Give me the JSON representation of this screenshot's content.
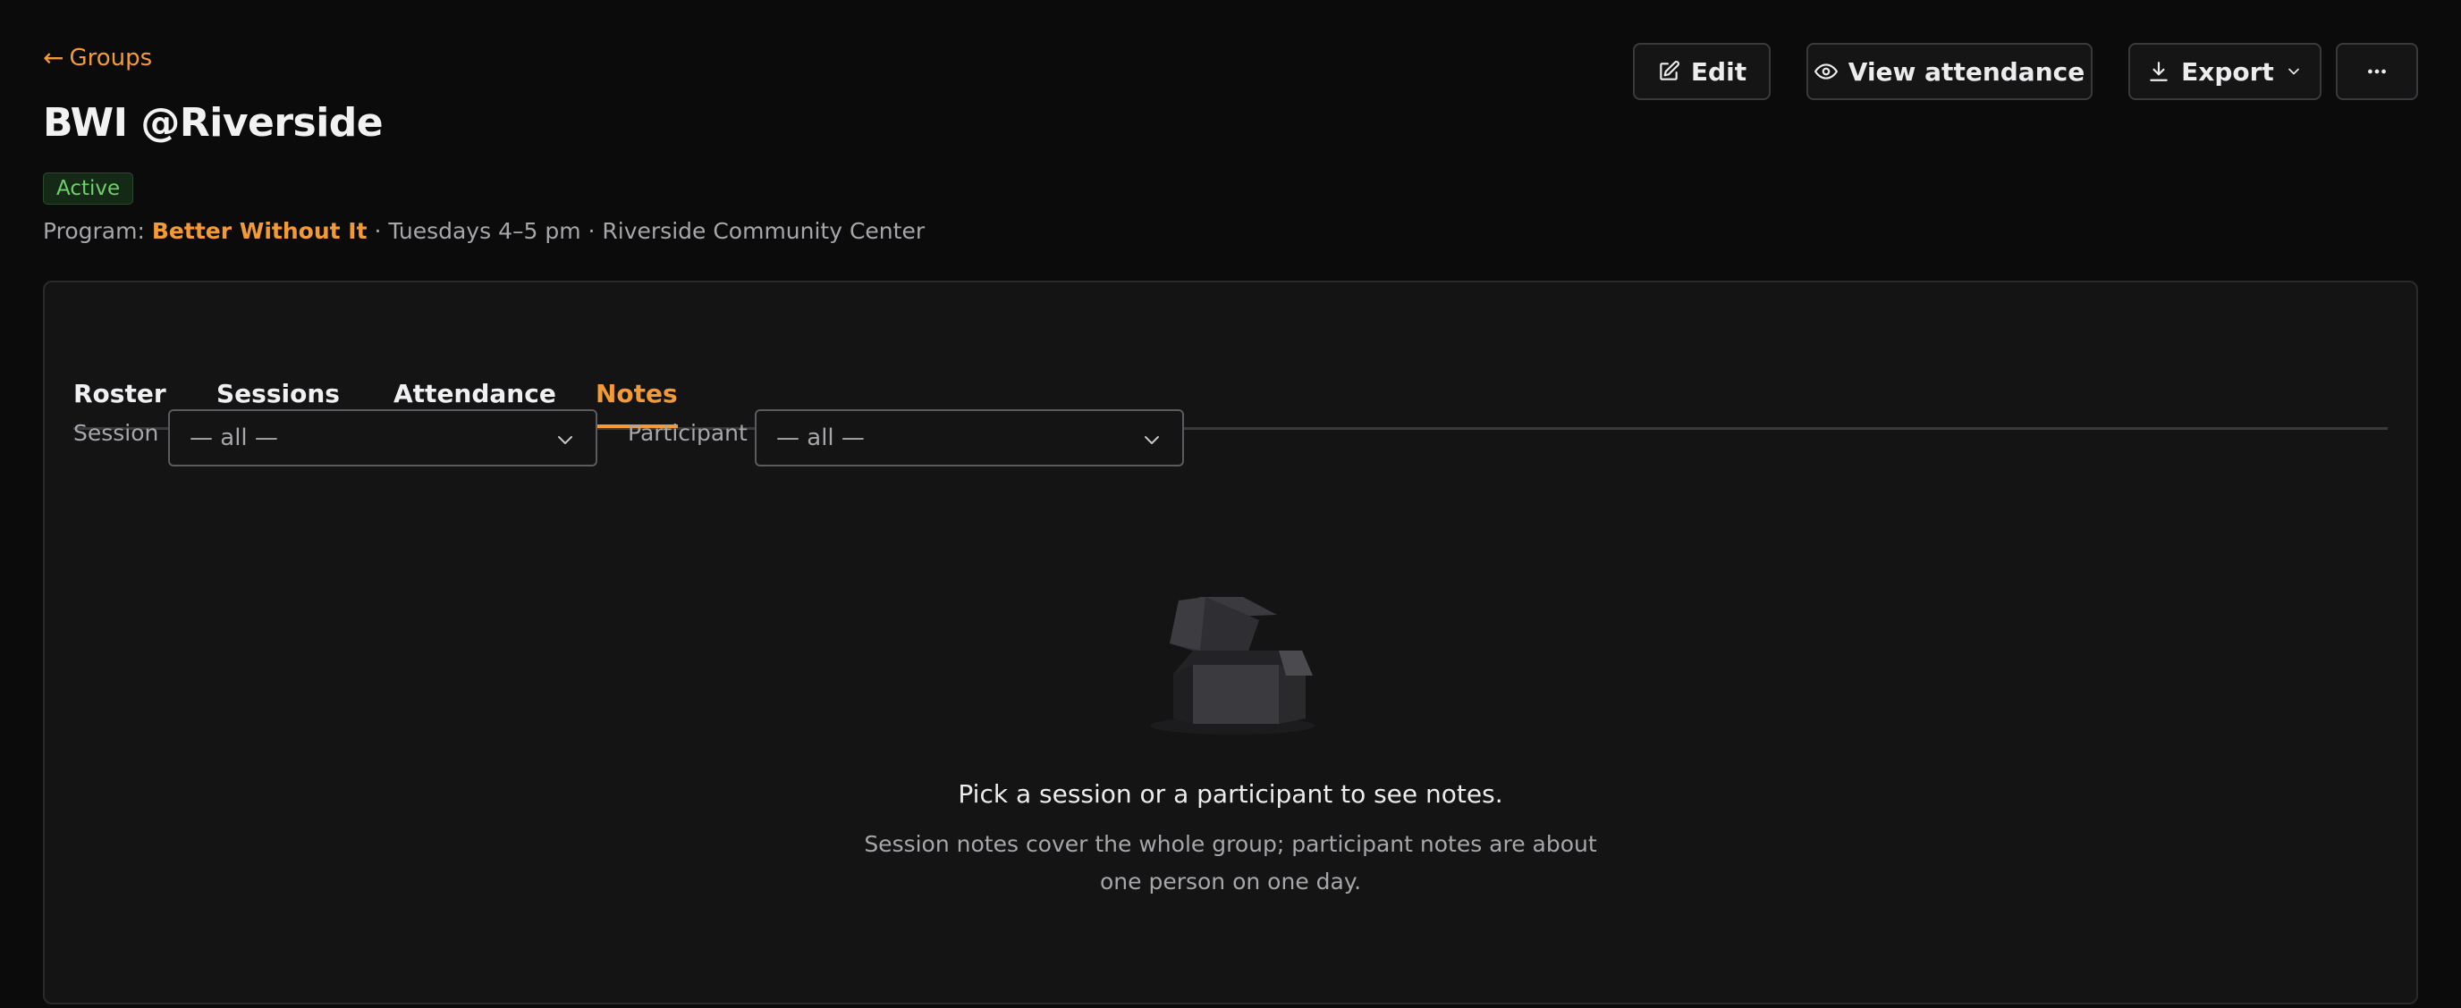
{
  "header": {
    "back_arrow": "←",
    "back_label": "Groups",
    "title": "BWI @Riverside",
    "status": "Active",
    "program_prefix": "Program:",
    "program_name": "Better Without It",
    "schedule_suffix": "· Tuesdays 4–5 pm · Riverside Community Center"
  },
  "toolbar": {
    "edit_label": "Edit",
    "view_attendance_label": "View attendance",
    "export_label": "Export",
    "edit_icon": "edit-icon",
    "view_icon": "eye-icon",
    "export_icon": "download-icon",
    "more_icon": "more-horizontal-icon"
  },
  "tabs": [
    {
      "label": "Roster",
      "active": false
    },
    {
      "label": "Sessions",
      "active": false
    },
    {
      "label": "Attendance",
      "active": false
    },
    {
      "label": "Notes",
      "active": true
    }
  ],
  "filters": {
    "session_label": "Session",
    "session_value": "— all —",
    "participant_label": "Participant",
    "participant_value": "— all —"
  },
  "empty_state": {
    "illustration": "open-box-icon",
    "title": "Pick a session or a participant to see notes.",
    "subtitle": "Session notes cover the whole group; participant notes are about one person on one day."
  },
  "colors": {
    "accent": "#f29b34",
    "background": "#0b0b0c",
    "card": "#141415",
    "active_badge_text": "#6fcf6a",
    "active_badge_bg": "#142a16"
  }
}
